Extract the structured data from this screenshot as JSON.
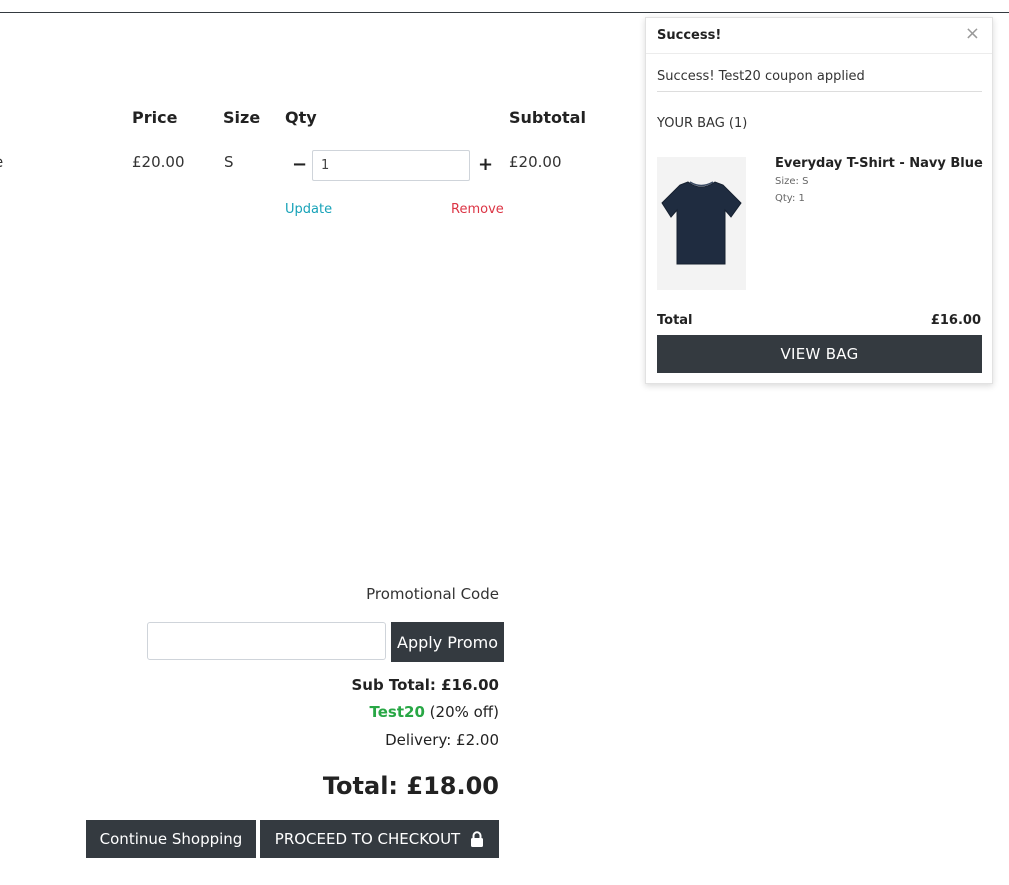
{
  "cart": {
    "edge_text": "e",
    "headers": {
      "price": "Price",
      "size": "Size",
      "qty": "Qty",
      "subtotal": "Subtotal"
    },
    "item": {
      "price": "£20.00",
      "size": "S",
      "qty_value": "1",
      "subtotal": "£20.00",
      "minus_symbol": "−",
      "plus_symbol": "+",
      "update_label": "Update",
      "remove_label": "Remove"
    }
  },
  "summary": {
    "promo_label": "Promotional Code",
    "promo_input_value": "",
    "apply_label": "Apply Promo",
    "subtotal_text": "Sub Total: £16.00",
    "coupon_code": "Test20",
    "coupon_discount": " (20% off)",
    "delivery_text": "Delivery: £2.00",
    "total_text": "Total: £18.00",
    "continue_label": "Continue Shopping",
    "checkout_label": "PROCEED TO CHECKOUT",
    "colors": {
      "coupon": "#28a745",
      "button_bg": "#343a40"
    }
  },
  "toast": {
    "title": "Success!",
    "close_symbol": "×",
    "message": "Success! Test20 coupon applied",
    "bag_title": "YOUR BAG (1)",
    "item_name": "Everyday T-Shirt - Navy Blue",
    "item_size": "Size: S",
    "item_qty": "Qty: 1",
    "total_label": "Total",
    "total_value": "£16.00",
    "view_bag_label": "VIEW BAG"
  },
  "icons": {
    "lock": "lock-icon",
    "close": "close-icon",
    "product": "tshirt-image"
  }
}
